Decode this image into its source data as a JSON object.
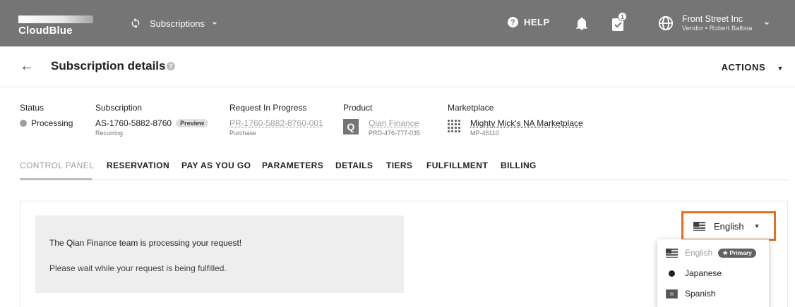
{
  "topbar": {
    "logo_text": "CloudBlue",
    "module_label": "Subscriptions",
    "help_label": "HELP",
    "tasks_badge": "1",
    "account_name": "Front Street Inc",
    "account_sub": "Vendor • Robert Balboa"
  },
  "header": {
    "title": "Subscription details",
    "actions_label": "ACTIONS"
  },
  "info": {
    "status": {
      "label": "Status",
      "value": "Processing"
    },
    "subscription": {
      "label": "Subscription",
      "value": "AS-1760-5882-8760",
      "chip": "Preview",
      "sub": "Recurring"
    },
    "request": {
      "label": "Request In Progress",
      "value": "PR-1760-5882-8760-001",
      "sub": "Purchase"
    },
    "product": {
      "label": "Product",
      "icon_letter": "Q",
      "value": "Qian Finance",
      "sub": "PRD-476-777-035"
    },
    "marketplace": {
      "label": "Marketplace",
      "value": "Mighty Mick's NA Marketplace",
      "sub": "MP-46110"
    }
  },
  "tabs": [
    "CONTROL PANEL",
    "RESERVATION",
    "PAY AS YOU GO",
    "PARAMETERS",
    "DETAILS",
    "TIERS",
    "FULFILLMENT",
    "BILLING"
  ],
  "notice": {
    "title": "The Qian Finance team is processing your request!",
    "text": "Please wait while your request is being fulfilled."
  },
  "language": {
    "selected": "English",
    "options": [
      {
        "label": "English",
        "badge": "★ Primary"
      },
      {
        "label": "Japanese"
      },
      {
        "label": "Spanish"
      }
    ]
  },
  "colors": {
    "topbar": "#757575",
    "highlight": "#e2701e"
  }
}
